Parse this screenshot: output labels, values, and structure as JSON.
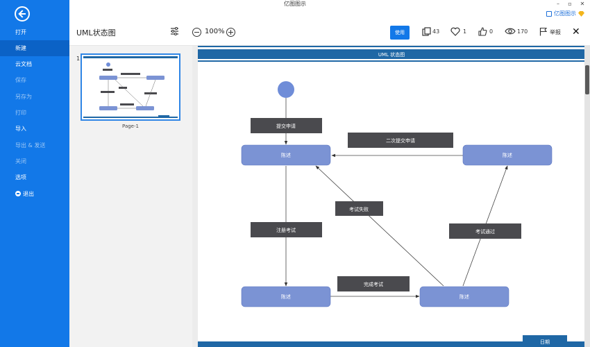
{
  "window": {
    "title": "亿图图示",
    "brand_label": "亿图图示",
    "minimize": "–",
    "restore": "▫",
    "close": "✕"
  },
  "sidebar": {
    "items": [
      {
        "label": "打开",
        "state": "normal"
      },
      {
        "label": "新建",
        "state": "active"
      },
      {
        "label": "云文档",
        "state": "normal"
      },
      {
        "label": "保存",
        "state": "disabled"
      },
      {
        "label": "另存为",
        "state": "disabled"
      },
      {
        "label": "打印",
        "state": "disabled"
      },
      {
        "label": "导入",
        "state": "normal"
      },
      {
        "label": "导出 & 发送",
        "state": "disabled"
      },
      {
        "label": "关闭",
        "state": "disabled"
      },
      {
        "label": "选项",
        "state": "normal"
      },
      {
        "label": "退出",
        "state": "normal"
      }
    ]
  },
  "toolbar": {
    "doc_title": "UML状态图",
    "zoom": "100%",
    "use_label": "使用",
    "copies": "43",
    "likes": "1",
    "thumbs_up": "0",
    "views": "170",
    "report_label": "举报"
  },
  "thumbnails": {
    "pages": [
      {
        "number": "1",
        "label": "Page-1"
      }
    ]
  },
  "diagram": {
    "header_title": "UML 状态图",
    "footer_label": "日期",
    "states": [
      {
        "id": "s1",
        "label": "陈述"
      },
      {
        "id": "s2",
        "label": "陈述"
      },
      {
        "id": "s3",
        "label": "陈述"
      },
      {
        "id": "s4",
        "label": "陈述"
      }
    ],
    "transitions": [
      {
        "label": "提交申请"
      },
      {
        "label": "二次提交申请"
      },
      {
        "label": "考试失败"
      },
      {
        "label": "注册考试"
      },
      {
        "label": "考试通过"
      },
      {
        "label": "完成考试"
      }
    ],
    "colors": {
      "state_fill": "#7b93d4",
      "state_stroke": "#5c76c0",
      "label_fill": "#4a4a4e",
      "header_bar": "#1f67a5",
      "initial_node": "#6f8dd8"
    }
  }
}
